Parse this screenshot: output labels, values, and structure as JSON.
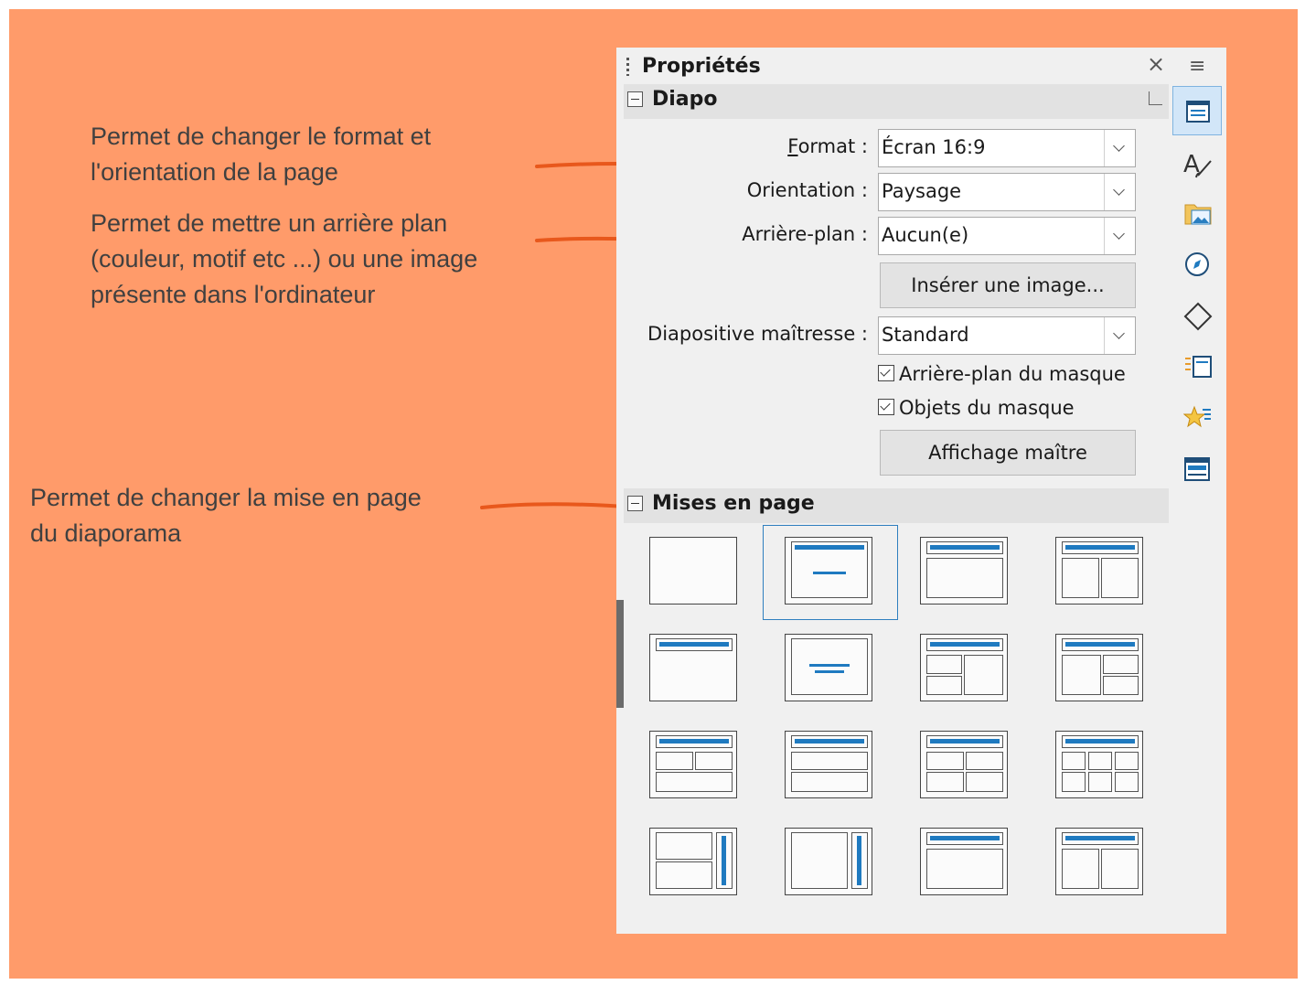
{
  "annotations": [
    {
      "lines": [
        "Permet de changer le format et",
        "l'orientation de la page"
      ]
    },
    {
      "lines": [
        "Permet de mettre un arrière plan",
        "(couleur, motif etc ...) ou une image",
        "présente dans l'ordinateur"
      ]
    },
    {
      "lines": [
        "Permet de changer la mise en page",
        "du diaporama"
      ]
    }
  ],
  "panel": {
    "title": "Propriétés",
    "close_glyph": "×",
    "menu_glyph": "≡",
    "sections": {
      "diapo": {
        "label": "Diapo",
        "format": {
          "accel": "F",
          "label_rest": "ormat :",
          "value": "Écran 16:9"
        },
        "orientation": {
          "label": "Orientation :",
          "value": "Paysage"
        },
        "background": {
          "label": "Arrière-plan :",
          "value": "Aucun(e)"
        },
        "insert_image_label": "Insérer une image...",
        "master": {
          "label": "Diapositive maîtresse :",
          "value": "Standard"
        },
        "master_background": {
          "label": "Arrière-plan du masque",
          "checked": true
        },
        "master_objects": {
          "label": "Objets du masque",
          "checked": true
        },
        "master_view_label": "Affichage maître"
      },
      "layouts": {
        "label": "Mises en page",
        "selected_index": 1,
        "items": [
          "blank",
          "title-content",
          "title-only",
          "title-two-columns",
          "title-top",
          "centered-text",
          "title-content-2-left",
          "title-2-right",
          "title-2-top-1-bottom",
          "title-2-rows",
          "title-4",
          "title-6",
          "vertical-title-2",
          "vertical-title-1",
          "title-vertical",
          "title-two-vertical"
        ]
      }
    },
    "sidebar_tabs": [
      "properties-icon",
      "styles-icon",
      "gallery-icon",
      "navigator-icon",
      "shapes-icon",
      "slide-transition-icon",
      "animation-icon",
      "master-slides-icon"
    ]
  },
  "colors": {
    "background": "#ff9b6a",
    "annotation_text": "#404040",
    "arrow": "#e8581c",
    "accent": "#1f7ac0"
  }
}
